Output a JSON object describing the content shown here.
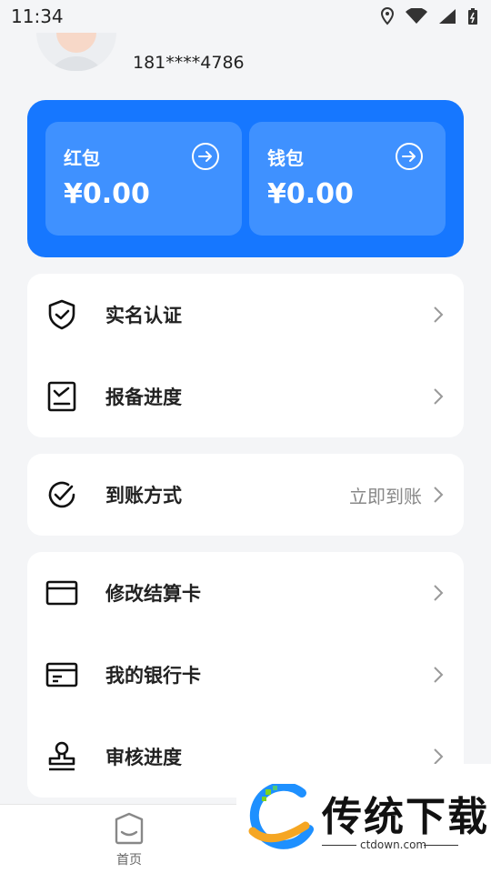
{
  "status": {
    "time": "11:34"
  },
  "profile": {
    "phone": "181****4786"
  },
  "wallet": {
    "red_label": "红包",
    "red_value": "¥0.00",
    "wallet_label": "钱包",
    "wallet_value": "¥0.00",
    "accent": "#1677ff"
  },
  "menu": {
    "realname": "实名认证",
    "progress": "报备进度",
    "arrival": "到账方式",
    "arrival_value": "立即到账",
    "modify_card": "修改结算卡",
    "my_cards": "我的银行卡",
    "review": "审核进度"
  },
  "tabbar": {
    "home": "首页"
  },
  "watermark": {
    "title": "传统下载",
    "site": "ctdown.com"
  }
}
